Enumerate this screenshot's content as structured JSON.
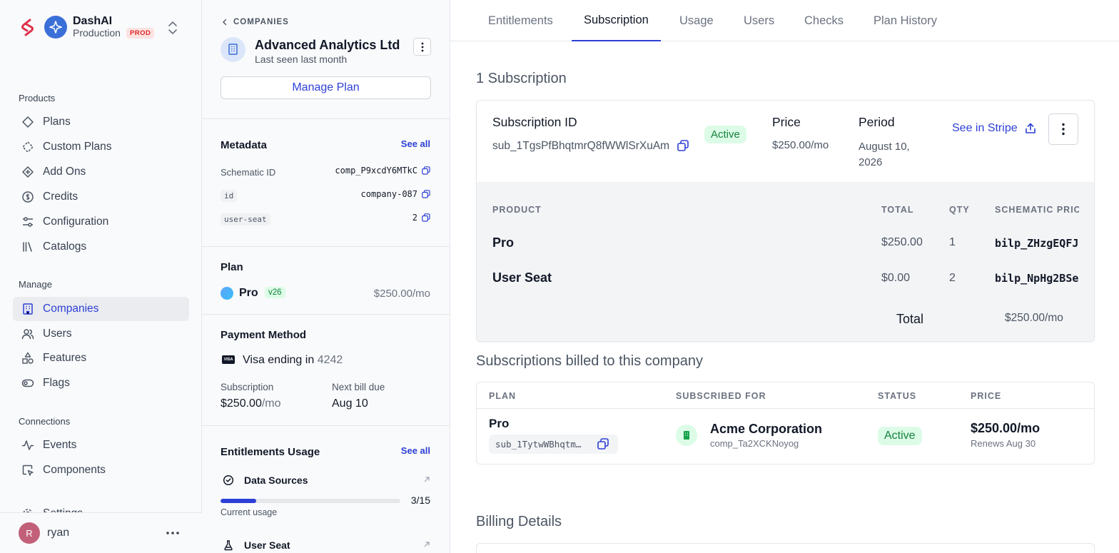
{
  "org": {
    "name": "DashAI",
    "env": "Production",
    "env_badge": "PROD"
  },
  "sidebar": {
    "products_label": "Products",
    "products": [
      {
        "label": "Plans",
        "icon": "diamond-icon"
      },
      {
        "label": "Custom Plans",
        "icon": "dashed-diamond-icon"
      },
      {
        "label": "Add Ons",
        "icon": "diamond-plus-icon"
      },
      {
        "label": "Credits",
        "icon": "dollar-circle-icon"
      },
      {
        "label": "Configuration",
        "icon": "sliders-icon"
      },
      {
        "label": "Catalogs",
        "icon": "library-icon"
      }
    ],
    "manage_label": "Manage",
    "manage": [
      {
        "label": "Companies",
        "icon": "building-icon"
      },
      {
        "label": "Users",
        "icon": "users-icon"
      },
      {
        "label": "Features",
        "icon": "shapes-icon"
      },
      {
        "label": "Flags",
        "icon": "toggle-icon"
      }
    ],
    "connections_label": "Connections",
    "connections": [
      {
        "label": "Events",
        "icon": "activity-icon"
      },
      {
        "label": "Components",
        "icon": "component-icon"
      }
    ],
    "settings_label": "Settings",
    "user": {
      "initial": "R",
      "name": "ryan"
    }
  },
  "company": {
    "breadcrumb": "COMPANIES",
    "name": "Advanced Analytics Ltd",
    "last_seen": "Last seen last month",
    "manage_plan": "Manage Plan",
    "metadata": {
      "title": "Metadata",
      "see_all": "See all",
      "rows": [
        {
          "key": "Schematic ID",
          "value": "comp_P9xcdY6MTkC"
        },
        {
          "key": "id",
          "value": "company-087"
        },
        {
          "key": "user-seat",
          "value": "2"
        }
      ]
    },
    "plan": {
      "title": "Plan",
      "name": "Pro",
      "version": "v26",
      "price": "$250.00/mo"
    },
    "payment": {
      "title": "Payment Method",
      "card_brand": "VISA",
      "card_text": "Visa ending in",
      "last4": "4242",
      "subscription_label": "Subscription",
      "subscription_amount": "$250.00",
      "subscription_unit": "/mo",
      "next_bill_label": "Next bill due",
      "next_bill_date": "Aug 10"
    },
    "entitlements": {
      "title": "Entitlements Usage",
      "see_all": "See all",
      "items": [
        {
          "name": "Data Sources",
          "count": "3/15",
          "used": 3,
          "limit": 15,
          "caption": "Current usage"
        },
        {
          "name": "User Seat"
        }
      ]
    }
  },
  "tabs": [
    {
      "label": "Entitlements"
    },
    {
      "label": "Subscription"
    },
    {
      "label": "Usage"
    },
    {
      "label": "Users"
    },
    {
      "label": "Checks"
    },
    {
      "label": "Plan History"
    }
  ],
  "subscription": {
    "count_title": "1 Subscription",
    "id_label": "Subscription ID",
    "id": "sub_1TgsPfBhqtmrQ8fWWlSrXuAm",
    "status": "Active",
    "price_label": "Price",
    "price": "$250.00/mo",
    "period_label": "Period",
    "period_line1": "August 10,",
    "period_line2": "2026",
    "stripe_link": "See in Stripe",
    "table": {
      "headers": [
        "PRODUCT",
        "TOTAL",
        "QTY",
        "SCHEMATIC PRIC"
      ],
      "rows": [
        {
          "product": "Pro",
          "total": "$250.00",
          "qty": "1",
          "price_id": "bilp_ZHzgEQFJ"
        },
        {
          "product": "User Seat",
          "total": "$0.00",
          "qty": "2",
          "price_id": "bilp_NpHg2BSe"
        }
      ],
      "total_label": "Total",
      "total_value": "$250.00/mo"
    }
  },
  "billed": {
    "title": "Subscriptions billed to this company",
    "headers": [
      "PLAN",
      "SUBSCRIBED FOR",
      "STATUS",
      "PRICE"
    ],
    "row": {
      "plan": "Pro",
      "sub_id": "sub_1TytwWBhqtm…",
      "company": "Acme Corporation",
      "company_id": "comp_Ta2XCKNoyog",
      "status": "Active",
      "price": "$250.00/mo",
      "renews": "Renews Aug 30"
    }
  },
  "billing_details": {
    "title": "Billing Details"
  },
  "colors": {
    "accent": "#2d3fd6",
    "active_bg": "#dcfce7",
    "active_text": "#15803d",
    "prod_badge": "#fee2e2"
  }
}
